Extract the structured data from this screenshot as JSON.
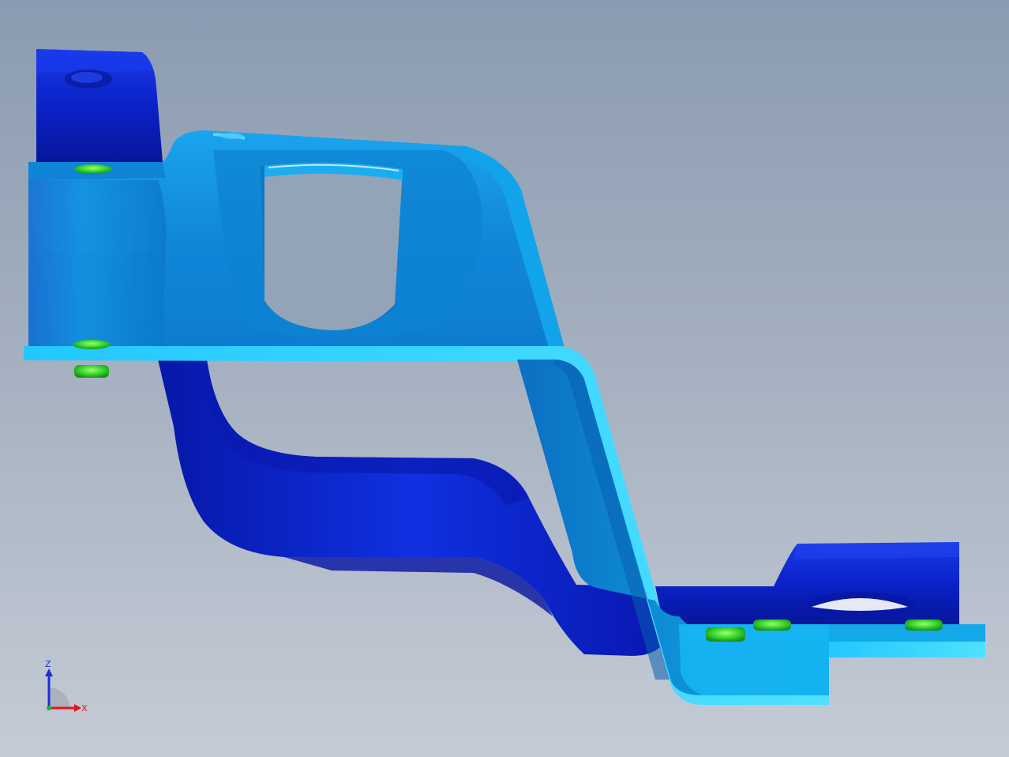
{
  "viewport": {
    "background_top": "#8a9bb1",
    "background_bottom": "#c4cbd5"
  },
  "model": {
    "colors": {
      "dark_face": "#0a22c8",
      "mid_face": "#0b8fd6",
      "light_face": "#12b8f2",
      "edge_highlight": "#2ad6ff",
      "hole_feature": "#2fd12b"
    }
  },
  "triad": {
    "x_label": "X",
    "z_label": "Z",
    "x_color": "#e01818",
    "z_color": "#1a2fd8",
    "y_color": "#19b43c"
  }
}
